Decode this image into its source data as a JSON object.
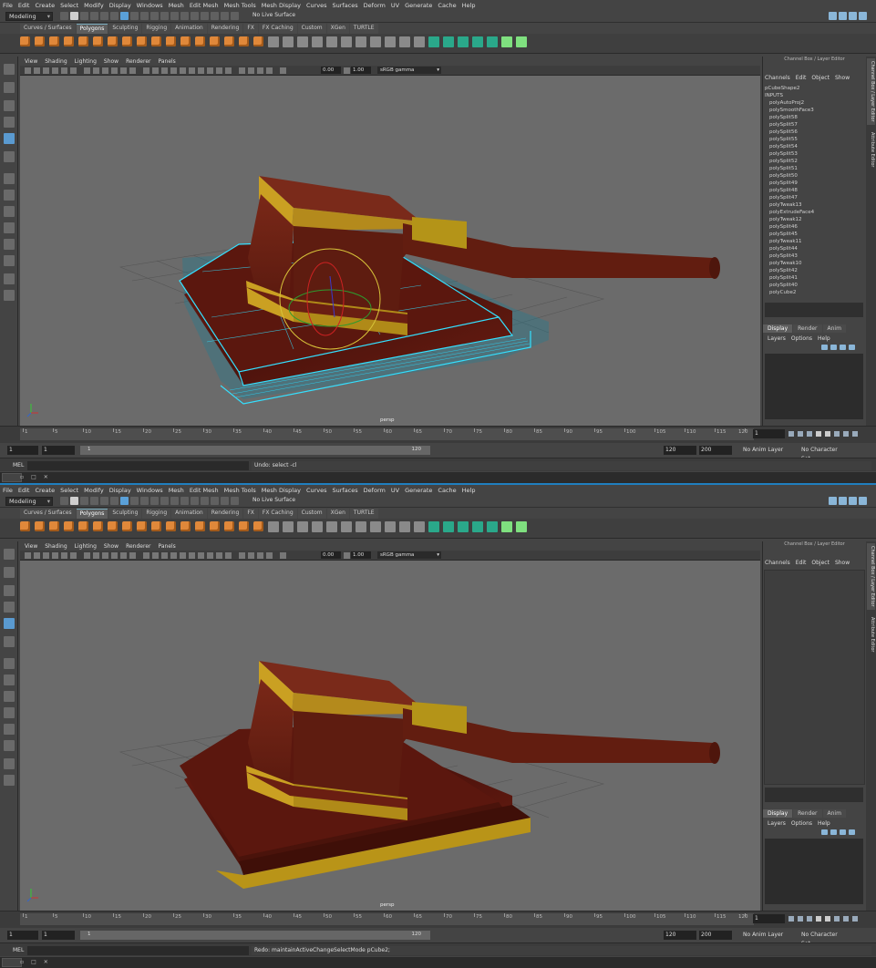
{
  "menu": [
    "File",
    "Edit",
    "Create",
    "Select",
    "Modify",
    "Display",
    "Windows",
    "Mesh",
    "Edit Mesh",
    "Mesh Tools",
    "Mesh Display",
    "Curves",
    "Surfaces",
    "Deform",
    "UV",
    "Generate",
    "Cache",
    "Help"
  ],
  "status": {
    "mode": "Modeling",
    "live_surface": "No Live Surface"
  },
  "shelf_tabs": [
    "Curves / Surfaces",
    "Polygons",
    "Sculpting",
    "Rigging",
    "Animation",
    "Rendering",
    "FX",
    "FX Caching",
    "Custom",
    "XGen",
    "TURTLE"
  ],
  "active_shelf": "Polygons",
  "panel_menu": [
    "View",
    "Shading",
    "Lighting",
    "Show",
    "Renderer",
    "Panels"
  ],
  "panel_fields": {
    "exposure": "0.00",
    "gamma": "1.00",
    "colorspace": "sRGB gamma"
  },
  "camera_label": "persp",
  "channel_box": {
    "title": "Channel Box / Layer Editor",
    "menu": [
      "Channels",
      "Edit",
      "Object",
      "Show"
    ],
    "shape_node": "pCubeShape2",
    "inputs_label": "INPUTS",
    "inputs": [
      "polyAutoProj2",
      "polySmoothFace3",
      "polySplit58",
      "polySplit57",
      "polySplit56",
      "polySplit55",
      "polySplit54",
      "polySplit53",
      "polySplit52",
      "polySplit51",
      "polySplit50",
      "polySplit49",
      "polySplit48",
      "polySplit47",
      "polyTweak13",
      "polyExtrudeFace4",
      "polyTweak12",
      "polySplit46",
      "polySplit45",
      "polyTweak11",
      "polySplit44",
      "polySplit43",
      "polyTweak10",
      "polySplit42",
      "polySplit41",
      "polySplit40",
      "polyCube2"
    ]
  },
  "layer_tabs": [
    "Display",
    "Render",
    "Anim"
  ],
  "layer_menu": [
    "Layers",
    "Options",
    "Help"
  ],
  "side_tabs": [
    "Channel Box / Layer Editor",
    "Attribute Editor"
  ],
  "timeline": {
    "ticks": [
      "1",
      "5",
      "10",
      "15",
      "20",
      "25",
      "30",
      "35",
      "40",
      "45",
      "50",
      "55",
      "60",
      "65",
      "70",
      "75",
      "80",
      "85",
      "90",
      "95",
      "100",
      "105",
      "110",
      "115",
      "120"
    ],
    "current_frame": "1"
  },
  "range": {
    "start": "1",
    "inner_start": "1",
    "range_start_label": "1",
    "range_end_label": "120",
    "end": "120",
    "out": "200",
    "anim_layer": "No Anim Layer",
    "char_set": "No Character Set"
  },
  "command": {
    "label": "MEL",
    "win1_result": "Undo: select -cl",
    "win2_result": "Redo: maintainActiveChangeSelectMode pCube2;"
  }
}
